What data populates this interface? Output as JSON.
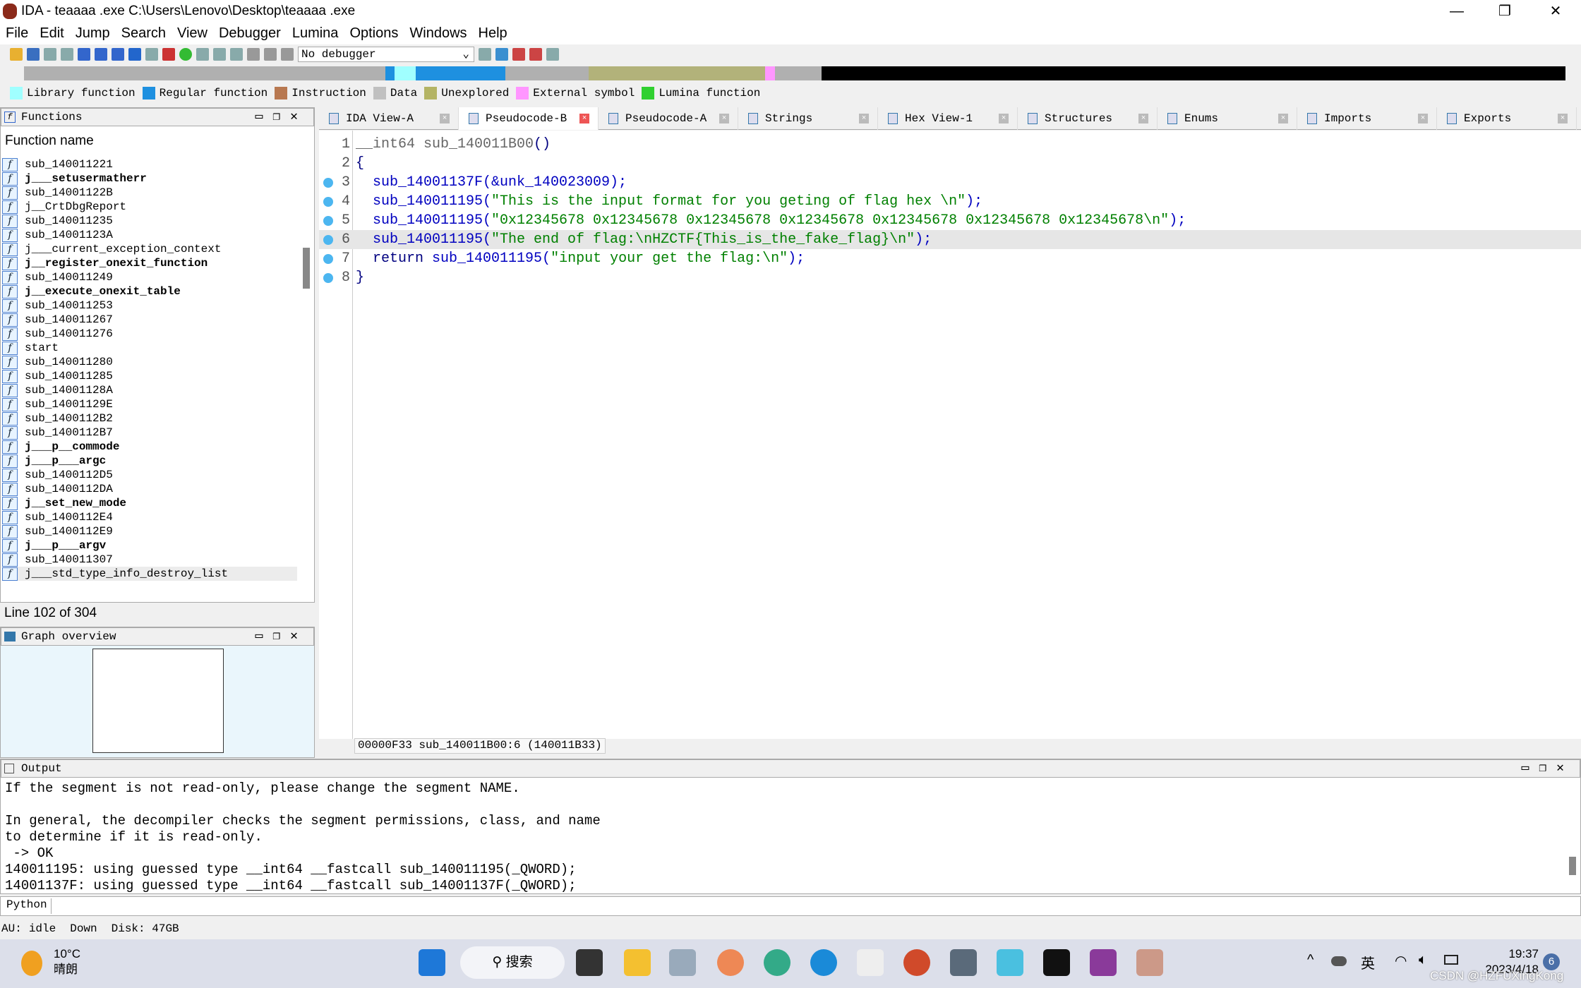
{
  "window": {
    "title": "IDA - teaaaa .exe C:\\Users\\Lenovo\\Desktop\\teaaaa .exe",
    "minimize": "—",
    "restore": "❐",
    "close": "✕"
  },
  "menu": [
    "File",
    "Edit",
    "Jump",
    "Search",
    "View",
    "Debugger",
    "Lumina",
    "Options",
    "Windows",
    "Help"
  ],
  "toolbar": {
    "debugger_select": "No debugger"
  },
  "legend": [
    {
      "label": "Library function",
      "color": "#a0ffff"
    },
    {
      "label": "Regular function",
      "color": "#1e90e0"
    },
    {
      "label": "Instruction",
      "color": "#b87850"
    },
    {
      "label": "Data",
      "color": "#c0c0c0"
    },
    {
      "label": "Unexplored",
      "color": "#b4b464"
    },
    {
      "label": "External symbol",
      "color": "#ff96ff"
    },
    {
      "label": "Lumina function",
      "color": "#30d030"
    }
  ],
  "functions": {
    "title": "Functions",
    "column": "Function name",
    "status": "Line 102 of 304",
    "items": [
      {
        "name": "sub_140011221",
        "bold": false
      },
      {
        "name": "j___setusermatherr",
        "bold": true
      },
      {
        "name": "sub_14001122B",
        "bold": false
      },
      {
        "name": "j__CrtDbgReport",
        "bold": false
      },
      {
        "name": "sub_140011235",
        "bold": false
      },
      {
        "name": "sub_14001123A",
        "bold": false
      },
      {
        "name": "j___current_exception_context",
        "bold": false
      },
      {
        "name": "j__register_onexit_function",
        "bold": true
      },
      {
        "name": "sub_140011249",
        "bold": false
      },
      {
        "name": "j__execute_onexit_table",
        "bold": true
      },
      {
        "name": "sub_140011253",
        "bold": false
      },
      {
        "name": "sub_140011267",
        "bold": false
      },
      {
        "name": "sub_140011276",
        "bold": false
      },
      {
        "name": "start",
        "bold": false
      },
      {
        "name": "sub_140011280",
        "bold": false
      },
      {
        "name": "sub_140011285",
        "bold": false
      },
      {
        "name": "sub_14001128A",
        "bold": false
      },
      {
        "name": "sub_14001129E",
        "bold": false
      },
      {
        "name": "sub_1400112B2",
        "bold": false
      },
      {
        "name": "sub_1400112B7",
        "bold": false
      },
      {
        "name": "j___p__commode",
        "bold": true
      },
      {
        "name": "j___p___argc",
        "bold": true
      },
      {
        "name": "sub_1400112D5",
        "bold": false
      },
      {
        "name": "sub_1400112DA",
        "bold": false
      },
      {
        "name": "j__set_new_mode",
        "bold": true
      },
      {
        "name": "sub_1400112E4",
        "bold": false
      },
      {
        "name": "sub_1400112E9",
        "bold": false
      },
      {
        "name": "j___p___argv",
        "bold": true
      },
      {
        "name": "sub_140011307",
        "bold": false
      },
      {
        "name": "j___std_type_info_destroy_list",
        "bold": false,
        "selected": true
      }
    ]
  },
  "graph_overview": {
    "title": "Graph overview"
  },
  "tabs": [
    {
      "label": "IDA View-A"
    },
    {
      "label": "Pseudocode-B",
      "active": true
    },
    {
      "label": "Pseudocode-A"
    },
    {
      "label": "Strings"
    },
    {
      "label": "Hex View-1"
    },
    {
      "label": "Structures"
    },
    {
      "label": "Enums"
    },
    {
      "label": "Imports"
    },
    {
      "label": "Exports"
    }
  ],
  "code": {
    "lines": [
      {
        "n": "1",
        "bp": false,
        "parts": [
          [
            "gr",
            "__int64 sub_140011B00"
          ],
          [
            "kw",
            "()"
          ]
        ]
      },
      {
        "n": "2",
        "bp": false,
        "parts": [
          [
            "kw",
            "{"
          ]
        ]
      },
      {
        "n": "3",
        "bp": true,
        "parts": [
          [
            "fn",
            "  sub_14001137F(&unk_140023009);"
          ]
        ]
      },
      {
        "n": "4",
        "bp": true,
        "parts": [
          [
            "fn",
            "  sub_140011195("
          ],
          [
            "str",
            "\"This is the input format for you geting of flag hex \\n\""
          ],
          [
            "fn",
            ");"
          ]
        ]
      },
      {
        "n": "5",
        "bp": true,
        "parts": [
          [
            "fn",
            "  sub_140011195("
          ],
          [
            "str",
            "\"0x12345678 0x12345678 0x12345678 0x12345678 0x12345678 0x12345678 0x12345678\\n\""
          ],
          [
            "fn",
            ");"
          ]
        ]
      },
      {
        "n": "6",
        "bp": true,
        "cur": true,
        "parts": [
          [
            "fn",
            "  sub_140011195("
          ],
          [
            "str",
            "\"The end of flag:\\nHZCTF{This_is_the_fake_flag}\\n\""
          ],
          [
            "fn",
            ");"
          ]
        ]
      },
      {
        "n": "7",
        "bp": true,
        "parts": [
          [
            "kw",
            "  return "
          ],
          [
            "fn",
            "sub_140011195("
          ],
          [
            "str",
            "\"input your get the flag:\\n\""
          ],
          [
            "fn",
            ");"
          ]
        ]
      },
      {
        "n": "8",
        "bp": true,
        "parts": [
          [
            "kw",
            "}"
          ]
        ]
      }
    ],
    "status": "00000F33 sub_140011B00:6 (140011B33)"
  },
  "output": {
    "title": "Output",
    "text": "If the segment is not read-only, please change the segment NAME.\n\nIn general, the decompiler checks the segment permissions, class, and name\nto determine if it is read-only.\n -> OK\n140011195: using guessed type __int64 __fastcall sub_140011195(_QWORD);\n14001137F: using guessed type __int64 __fastcall sub_14001137F(_QWORD);",
    "python": "Python"
  },
  "statusbar": {
    "au": "AU:",
    "state": "idle",
    "dir": "Down",
    "disk": "Disk: 47GB"
  },
  "taskbar": {
    "temp": "10°C",
    "weather": "晴朗",
    "search": "搜索",
    "time": "19:37",
    "date": "2023/4/18",
    "ime": "英",
    "notif": "6",
    "watermark": "CSDN @HZFUXingKong"
  }
}
